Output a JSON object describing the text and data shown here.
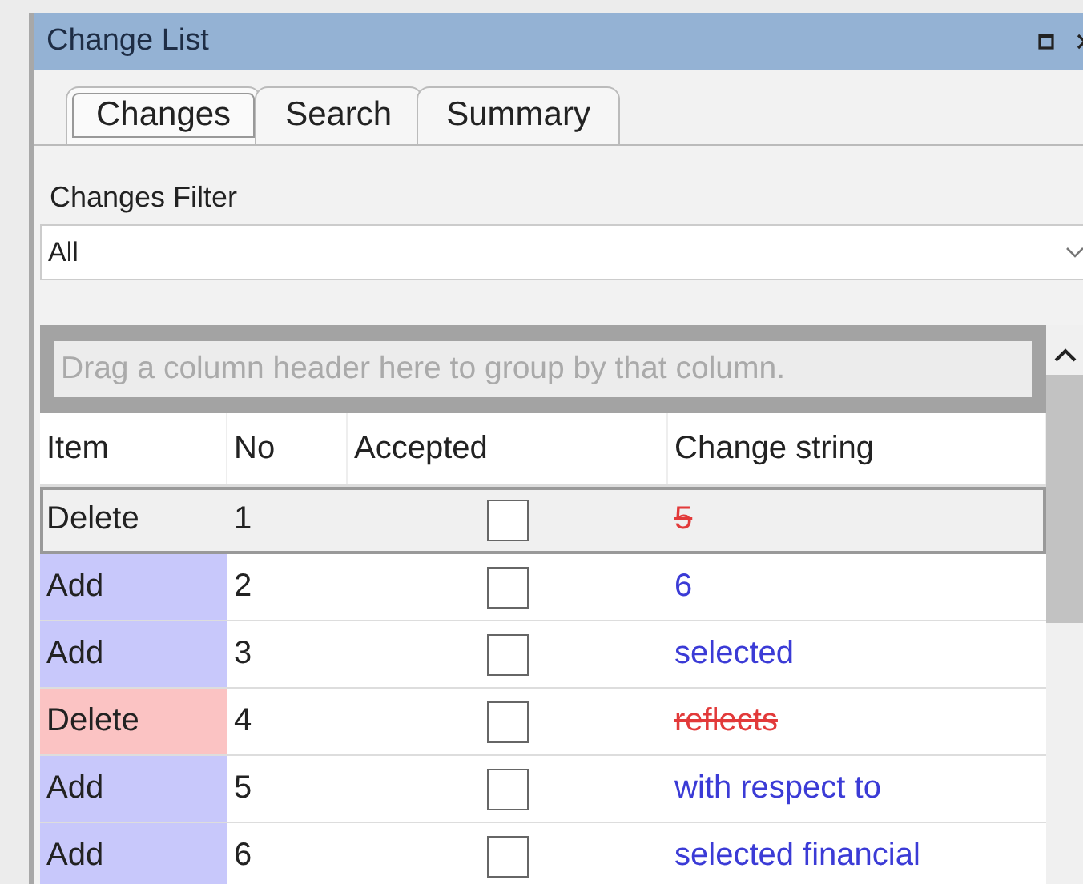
{
  "window": {
    "title": "Change List"
  },
  "tabs": [
    {
      "label": "Changes",
      "selected": true
    },
    {
      "label": "Search",
      "selected": false
    },
    {
      "label": "Summary",
      "selected": false
    }
  ],
  "filter": {
    "label": "Changes Filter",
    "value": "All"
  },
  "grid": {
    "group_hint": "Drag a column header here to group by that column.",
    "columns": [
      "Item",
      "No",
      "Accepted",
      "Change string"
    ],
    "rows": [
      {
        "item": "Delete",
        "kind": "delete",
        "no": "1",
        "accepted": false,
        "change": "5",
        "selected": true
      },
      {
        "item": "Add",
        "kind": "add",
        "no": "2",
        "accepted": false,
        "change": "6",
        "selected": false
      },
      {
        "item": "Add",
        "kind": "add",
        "no": "3",
        "accepted": false,
        "change": "selected",
        "selected": false
      },
      {
        "item": "Delete",
        "kind": "delete",
        "no": "4",
        "accepted": false,
        "change": "reflects",
        "selected": false
      },
      {
        "item": "Add",
        "kind": "add",
        "no": "5",
        "accepted": false,
        "change": "with respect to",
        "selected": false
      },
      {
        "item": "Add",
        "kind": "add",
        "no": "6",
        "accepted": false,
        "change": "selected financial",
        "selected": false
      }
    ]
  }
}
